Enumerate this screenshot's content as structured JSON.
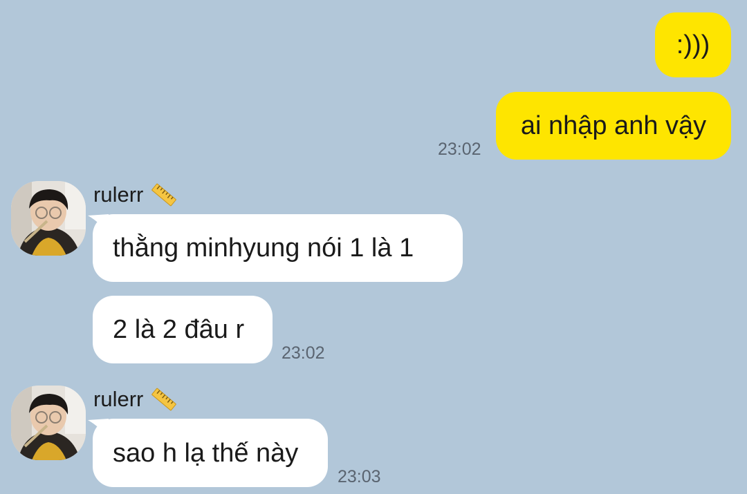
{
  "colors": {
    "background": "#b2c7d9",
    "outgoing_bubble": "#fee500",
    "incoming_bubble": "#ffffff",
    "timestamp": "#5a6470"
  },
  "messages": {
    "out_1": {
      "text": ":)))"
    },
    "out_2": {
      "text": "ai nhập anh vậy",
      "time": "23:02"
    },
    "group_1": {
      "sender": "rulerr",
      "sender_icon": "ruler-icon",
      "msg_1": {
        "text": "thằng minhyung nói 1 là 1"
      },
      "msg_2": {
        "text": "2 là 2 đâu r",
        "time": "23:02"
      }
    },
    "group_2": {
      "sender": "rulerr",
      "sender_icon": "ruler-icon",
      "msg_1": {
        "text": "sao h lạ thế này",
        "time": "23:03"
      }
    }
  }
}
